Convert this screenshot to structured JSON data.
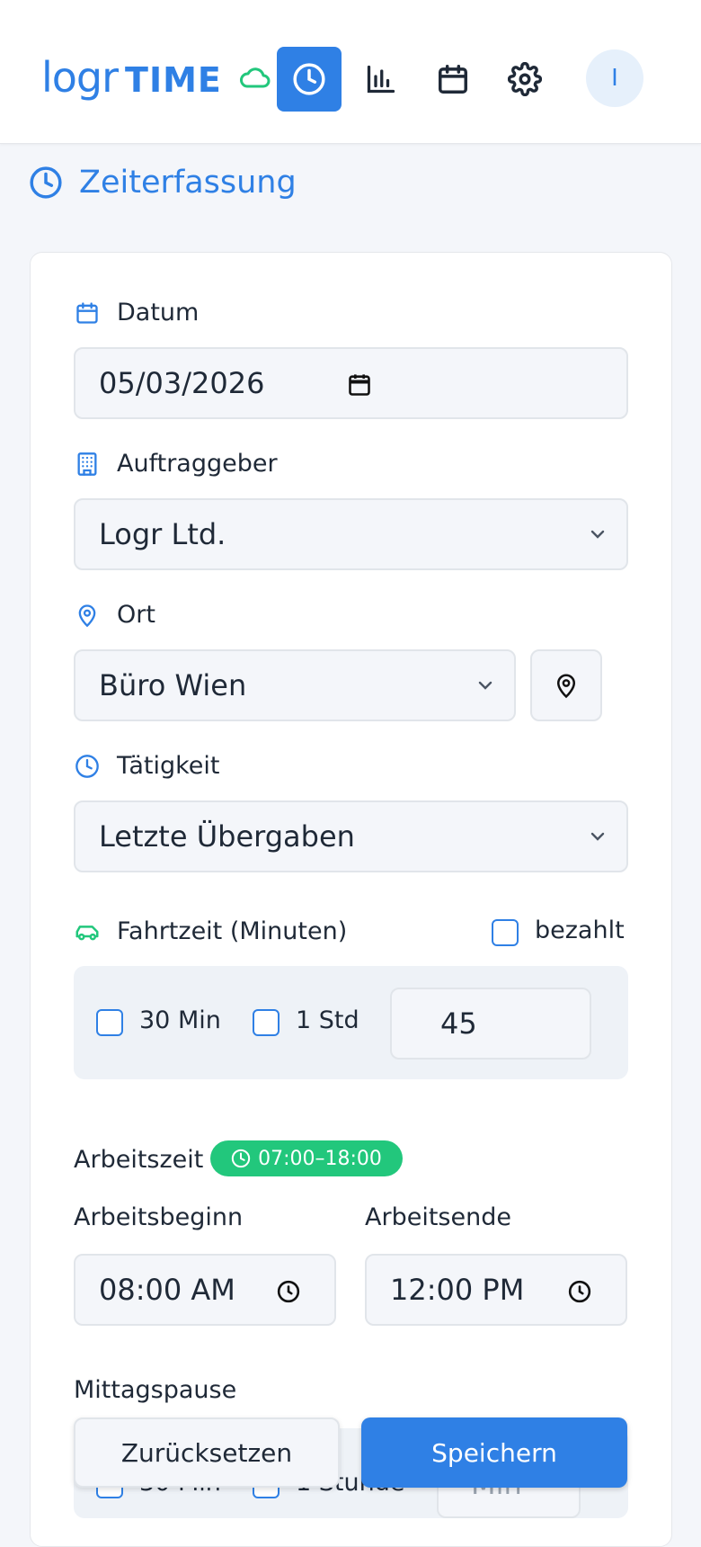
{
  "header": {
    "logo_main": "logr",
    "logo_sub": "TIME",
    "avatar_initial": "I"
  },
  "page": {
    "title": "Zeiterfassung"
  },
  "form": {
    "date_label": "Datum",
    "date_value": "05/03/2026",
    "client_label": "Auftraggeber",
    "client_value": "Logr Ltd.",
    "location_label": "Ort",
    "location_value": "Büro Wien",
    "activity_label": "Tätigkeit",
    "activity_value": "Letzte Übergaben",
    "travel_label": "Fahrtzeit (Minuten)",
    "travel_paid_label": "bezahlt",
    "travel_30_label": "30 Min",
    "travel_1h_label": "1 Std",
    "travel_minutes_value": "45",
    "worktime_label": "Arbeitszeit",
    "worktime_badge": "07:00–18:00",
    "start_label": "Arbeitsbeginn",
    "start_value": "08:00 AM",
    "end_label": "Arbeitsende",
    "end_value": "12:00 PM",
    "lunch_label": "Mittagspause",
    "lunch_30_label": "30 Min",
    "lunch_1h_label": "1 Stunde",
    "lunch_placeholder": "Min"
  },
  "actions": {
    "reset_label": "Zurücksetzen",
    "save_label": "Speichern"
  },
  "colors": {
    "accent": "#2f80e5",
    "success": "#22c77c",
    "background": "#f4f6fa"
  },
  "icons": [
    "cloud-icon",
    "clock-icon",
    "chart-icon",
    "calendar-icon",
    "gear-icon",
    "building-icon",
    "map-pin-icon",
    "car-icon",
    "chevron-down-icon"
  ]
}
